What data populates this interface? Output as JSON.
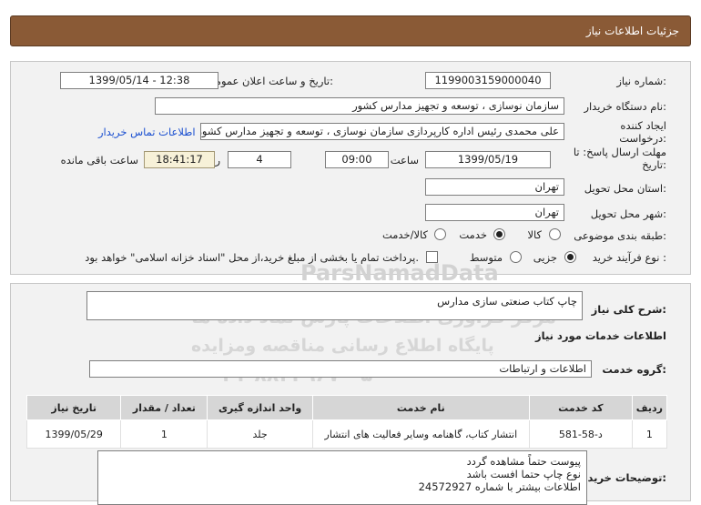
{
  "header": {
    "title": "جزئیات اطلاعات نیاز"
  },
  "form": {
    "need_number_label": "شماره نیاز:",
    "need_number": "1199003159000040",
    "announce_label": "تاریخ و ساعت اعلان عمومی:",
    "announce_value": "1399/05/14 - 12:38",
    "buyer_org_label": "نام دستگاه خریدار:",
    "buyer_org": "سازمان نوسازی ، توسعه و تجهیز مدارس کشور",
    "creator_label": "ایجاد کننده درخواست:",
    "creator": "علی محمدی رئیس اداره کارپردازی سازمان نوسازی ، توسعه و تجهیز مدارس کشور",
    "buyer_contact_link": "اطلاعات تماس خریدار",
    "deadline_label": "مهلت ارسال پاسخ: تا تاریخ:",
    "deadline_date": "1399/05/19",
    "time_label": "ساعت",
    "deadline_time": "09:00",
    "days": "4",
    "days_label": "روز و",
    "remaining_time": "18:41:17",
    "remaining_label": "ساعت باقی مانده",
    "province_label": "استان محل تحویل:",
    "province": "تهران",
    "city_label": "شهر محل تحویل:",
    "city": "تهران",
    "category_label": "طبقه بندی موضوعی:",
    "category_options": [
      "کالا",
      "خدمت",
      "کالا/خدمت"
    ],
    "category_selected": "خدمت",
    "process_label": "نوع فرآیند خرید :",
    "process_options": [
      "جزیی",
      "متوسط"
    ],
    "process_selected": "جزیی",
    "payment_note": "پرداخت تمام یا بخشی از مبلغ خرید،از محل \"اسناد خزانه اسلامی\" خواهد بود."
  },
  "watermark": {
    "brand": "ParsNamadData",
    "line1": "مرکز فراوری اطلاعات پارس نماد داده ها",
    "line2": "پایگاه اطلاع رسانی مناقصه ومزایده",
    "phone": "۰۲۱-۸۸۳۴۹۶۷۰-۵"
  },
  "summary": {
    "general_desc_label": "شرح کلی نیاز:",
    "general_desc": "چاپ کتاب صنعتی سازی مدارس",
    "services_info_title": "اطلاعات خدمات مورد نیاز",
    "service_group_label": "گروه خدمت:",
    "service_group": "اطلاعات و ارتباطات"
  },
  "table": {
    "headers": [
      "ردیف",
      "کد خدمت",
      "نام خدمت",
      "واحد اندازه گیری",
      "تعداد / مقدار",
      "تاریخ نیاز"
    ],
    "rows": [
      [
        "1",
        "د-58-581",
        "انتشار کتاب، گاهنامه وسایر فعالیت های انتشار",
        "جلد",
        "1",
        "1399/05/29"
      ]
    ]
  },
  "buyer_notes": {
    "label": "توضیحات خریدار:",
    "lines": [
      "پیوست حتماً مشاهده گردد",
      "نوع چاپ حتما افست باشد",
      "اطلاعات بیشتر با شماره 24572927"
    ]
  }
}
